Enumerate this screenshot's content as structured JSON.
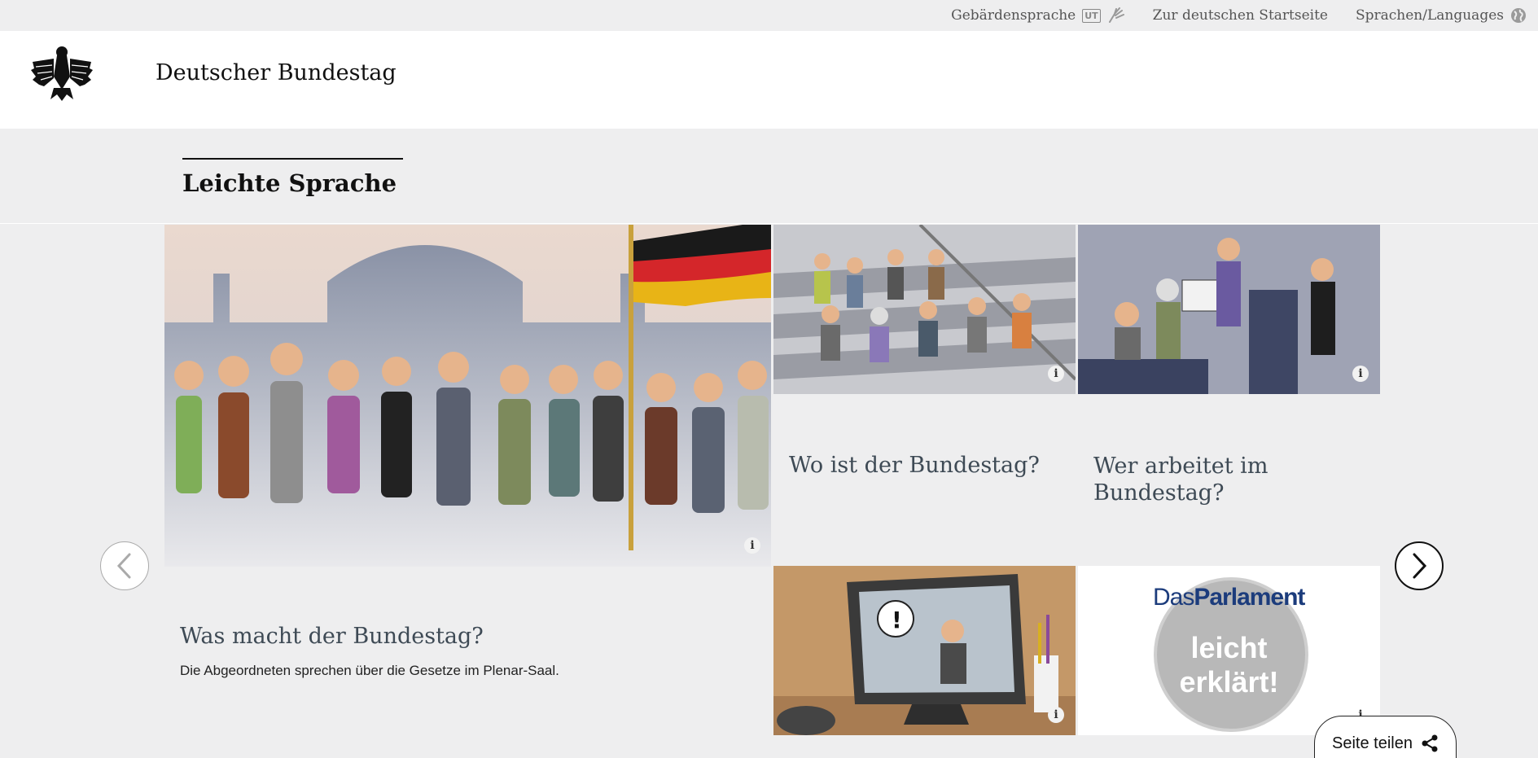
{
  "topbar": {
    "sign_language": "Gebärdensprache",
    "ut_badge": "UT",
    "german_home": "Zur deutschen Startseite",
    "languages": "Sprachen/Languages"
  },
  "header": {
    "site_title": "Deutscher Bundestag"
  },
  "section": {
    "title": "Leichte Sprache"
  },
  "tiles": [
    {
      "title": "Was macht der Bundestag?",
      "text": "Die Abgeordneten sprechen über die Gesetze im Plenar-Saal."
    },
    {
      "title": "Wo ist der Bundestag?"
    },
    {
      "title": "Wer arbeitet im Bundestag?"
    },
    {
      "title": ""
    },
    {
      "logo_das": "Das",
      "logo_parlament": "Parlament",
      "logo_line1": "leicht",
      "logo_line2": "erklärt!"
    }
  ],
  "info_glyph": "i",
  "share": {
    "label": "Seite teilen"
  },
  "colors": {
    "background": "#eeeeef",
    "header": "#ffffff",
    "tile_title": "#3e4a55",
    "logo_blue": "#1c3c7c"
  }
}
